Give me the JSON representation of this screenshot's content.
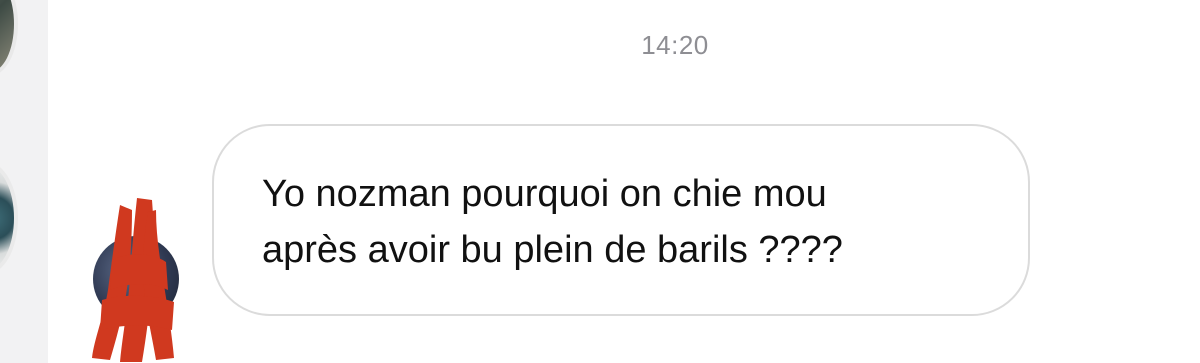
{
  "conversation": {
    "timestamp": "14:20",
    "messages": [
      {
        "lines": [
          "Yo nozman pourquoi on chie mou",
          "après avoir bu plein de barils ????"
        ]
      }
    ]
  },
  "colors": {
    "timestamp": "#8e8e93",
    "bubble_border": "#dbdbdb",
    "text": "#111111",
    "redaction": "#d0391f",
    "sidebar": "#f2f2f3"
  },
  "icons": {
    "sender_avatar": "avatar",
    "redaction": "red-marker-scribble"
  }
}
